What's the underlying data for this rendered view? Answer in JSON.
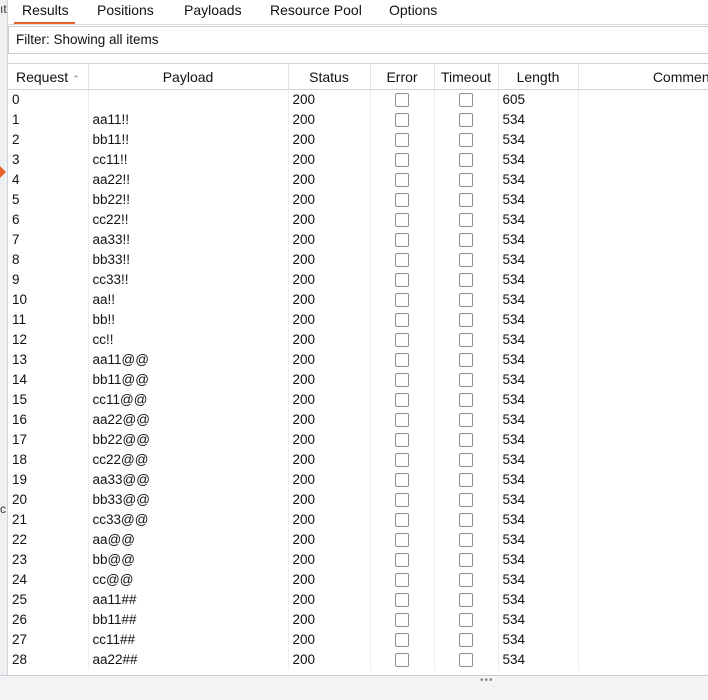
{
  "left_strip": {
    "fragment_top": "ıt",
    "fragment_mid": "c"
  },
  "tabs": [
    {
      "label": "Results",
      "active": true
    },
    {
      "label": "Positions",
      "active": false
    },
    {
      "label": "Payloads",
      "active": false
    },
    {
      "label": "Resource Pool",
      "active": false
    },
    {
      "label": "Options",
      "active": false
    }
  ],
  "filter": {
    "text": "Filter: Showing all items"
  },
  "table": {
    "columns": [
      "Request",
      "Payload",
      "Status",
      "Error",
      "Timeout",
      "Length",
      "Comment"
    ],
    "sort_column": "Request",
    "sort_direction": "ascending",
    "rows": [
      {
        "request": "0",
        "payload": "",
        "status": "200",
        "error": false,
        "timeout": false,
        "length": "605",
        "comment": ""
      },
      {
        "request": "1",
        "payload": "aa11!!",
        "status": "200",
        "error": false,
        "timeout": false,
        "length": "534",
        "comment": ""
      },
      {
        "request": "2",
        "payload": "bb11!!",
        "status": "200",
        "error": false,
        "timeout": false,
        "length": "534",
        "comment": ""
      },
      {
        "request": "3",
        "payload": "cc11!!",
        "status": "200",
        "error": false,
        "timeout": false,
        "length": "534",
        "comment": ""
      },
      {
        "request": "4",
        "payload": "aa22!!",
        "status": "200",
        "error": false,
        "timeout": false,
        "length": "534",
        "comment": ""
      },
      {
        "request": "5",
        "payload": "bb22!!",
        "status": "200",
        "error": false,
        "timeout": false,
        "length": "534",
        "comment": ""
      },
      {
        "request": "6",
        "payload": "cc22!!",
        "status": "200",
        "error": false,
        "timeout": false,
        "length": "534",
        "comment": ""
      },
      {
        "request": "7",
        "payload": "aa33!!",
        "status": "200",
        "error": false,
        "timeout": false,
        "length": "534",
        "comment": ""
      },
      {
        "request": "8",
        "payload": "bb33!!",
        "status": "200",
        "error": false,
        "timeout": false,
        "length": "534",
        "comment": ""
      },
      {
        "request": "9",
        "payload": "cc33!!",
        "status": "200",
        "error": false,
        "timeout": false,
        "length": "534",
        "comment": ""
      },
      {
        "request": "10",
        "payload": "aa!!",
        "status": "200",
        "error": false,
        "timeout": false,
        "length": "534",
        "comment": ""
      },
      {
        "request": "11",
        "payload": "bb!!",
        "status": "200",
        "error": false,
        "timeout": false,
        "length": "534",
        "comment": ""
      },
      {
        "request": "12",
        "payload": "cc!!",
        "status": "200",
        "error": false,
        "timeout": false,
        "length": "534",
        "comment": ""
      },
      {
        "request": "13",
        "payload": "aa11@@",
        "status": "200",
        "error": false,
        "timeout": false,
        "length": "534",
        "comment": ""
      },
      {
        "request": "14",
        "payload": "bb11@@",
        "status": "200",
        "error": false,
        "timeout": false,
        "length": "534",
        "comment": ""
      },
      {
        "request": "15",
        "payload": "cc11@@",
        "status": "200",
        "error": false,
        "timeout": false,
        "length": "534",
        "comment": ""
      },
      {
        "request": "16",
        "payload": "aa22@@",
        "status": "200",
        "error": false,
        "timeout": false,
        "length": "534",
        "comment": ""
      },
      {
        "request": "17",
        "payload": "bb22@@",
        "status": "200",
        "error": false,
        "timeout": false,
        "length": "534",
        "comment": ""
      },
      {
        "request": "18",
        "payload": "cc22@@",
        "status": "200",
        "error": false,
        "timeout": false,
        "length": "534",
        "comment": ""
      },
      {
        "request": "19",
        "payload": "aa33@@",
        "status": "200",
        "error": false,
        "timeout": false,
        "length": "534",
        "comment": ""
      },
      {
        "request": "20",
        "payload": "bb33@@",
        "status": "200",
        "error": false,
        "timeout": false,
        "length": "534",
        "comment": ""
      },
      {
        "request": "21",
        "payload": "cc33@@",
        "status": "200",
        "error": false,
        "timeout": false,
        "length": "534",
        "comment": ""
      },
      {
        "request": "22",
        "payload": "aa@@",
        "status": "200",
        "error": false,
        "timeout": false,
        "length": "534",
        "comment": ""
      },
      {
        "request": "23",
        "payload": "bb@@",
        "status": "200",
        "error": false,
        "timeout": false,
        "length": "534",
        "comment": ""
      },
      {
        "request": "24",
        "payload": "cc@@",
        "status": "200",
        "error": false,
        "timeout": false,
        "length": "534",
        "comment": ""
      },
      {
        "request": "25",
        "payload": "aa11##",
        "status": "200",
        "error": false,
        "timeout": false,
        "length": "534",
        "comment": ""
      },
      {
        "request": "26",
        "payload": "bb11##",
        "status": "200",
        "error": false,
        "timeout": false,
        "length": "534",
        "comment": ""
      },
      {
        "request": "27",
        "payload": "cc11##",
        "status": "200",
        "error": false,
        "timeout": false,
        "length": "534",
        "comment": ""
      },
      {
        "request": "28",
        "payload": "aa22##",
        "status": "200",
        "error": false,
        "timeout": false,
        "length": "534",
        "comment": ""
      }
    ]
  },
  "colors": {
    "accent": "#e8622c",
    "border": "#d0d3d7"
  },
  "icons": {
    "sort": "sort-ascending-icon",
    "resize": "resize-grip-icon"
  }
}
